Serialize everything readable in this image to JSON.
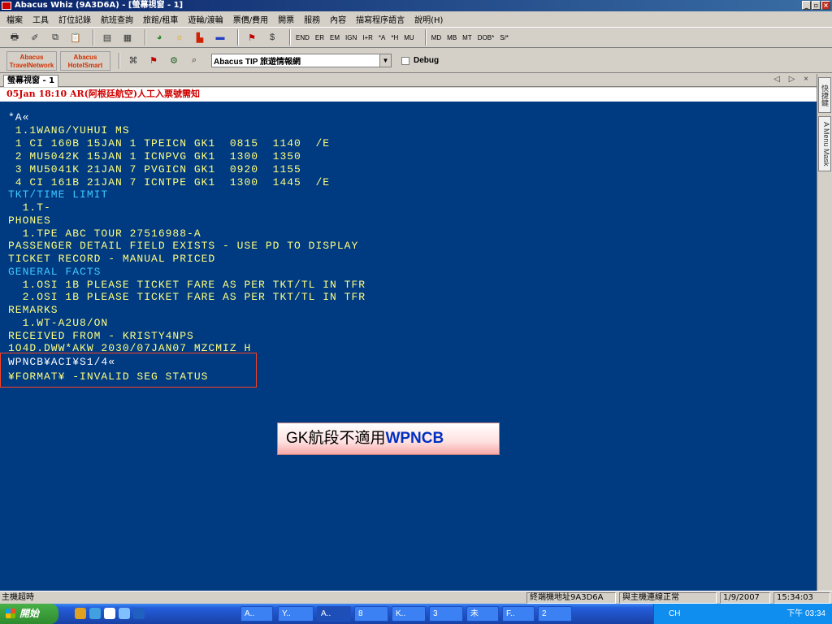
{
  "window": {
    "title": "Abacus Whiz (9A3D6A) - [螢幕視窗 - 1]",
    "minimize": "_",
    "restore": "▫",
    "close": "×"
  },
  "menu": [
    "檔案",
    "工具",
    "訂位記錄",
    "航班查詢",
    "旅館/租車",
    "遊輪/渡輪",
    "票價/費用",
    "開票",
    "服務",
    "內容",
    "描寫程序語言",
    "說明(H)"
  ],
  "toolbar1": {
    "icons": [
      "printer-icon",
      "eraser-icon",
      "copy-icon",
      "paste-icon",
      "document-icon",
      "form-icon",
      "globe-clock-icon",
      "weather-icon",
      "hotel-icon",
      "car-icon",
      "cruise-icon",
      "money-icon"
    ],
    "commands": [
      "END",
      "ER",
      "EM",
      "IGN",
      "I+R",
      "*A",
      "*H",
      "MU",
      "MD",
      "MB",
      "MT",
      "DOB*",
      "S/*"
    ]
  },
  "toolbar2": {
    "brand1": "Abacus TravelNetwork",
    "brand2": "Abacus HotelSmart",
    "combo_value": "Abacus TIP 旅遊情報網",
    "debug_label": "Debug"
  },
  "tab": {
    "label": "螢幕視窗 - 1",
    "nav": "◁ ▷ ×"
  },
  "notice": "05Jan 18:10 AR(阿根廷航空)人工入票號需知",
  "terminal_lines": [
    "*A«",
    " 1.1WANG/YUHUI MS",
    " 1 CI 160B 15JAN 1 TPEICN GK1  0815  1140  /E",
    " 2 MU5042K 15JAN 1 ICNPVG GK1  1300  1350",
    " 3 MU5041K 21JAN 7 PVGICN GK1  0920  1155",
    " 4 CI 161B 21JAN 7 ICNTPE GK1  1300  1445  /E",
    "TKT/TIME LIMIT",
    "  1.T-",
    "PHONES",
    "  1.TPE ABC TOUR 27516988-A",
    "PASSENGER DETAIL FIELD EXISTS - USE PD TO DISPLAY",
    "TICKET RECORD - MANUAL PRICED",
    "GENERAL FACTS",
    "  1.OSI 1B PLEASE TICKET FARE AS PER TKT/TL IN TFR",
    "  2.OSI 1B PLEASE TICKET FARE AS PER TKT/TL IN TFR",
    "REMARKS",
    "  1.WT-A2U8/ON",
    "RECEIVED FROM - KRISTY4NPS",
    "1O4D.DWW*AKW 2030/07JAN07 MZCMIZ H",
    "WPNCB¥ACI¥S1/4«",
    "¥FORMAT¥ -INVALID SEG STATUS"
  ],
  "callout": {
    "text": "GK航段不適用",
    "highlight": "WPNCB"
  },
  "sidebar": {
    "btn1": "快捷鍵",
    "btn2": "A Menu Mask"
  },
  "statusbar": {
    "left": "主機超時",
    "terminal_address": "終端機地址9A3D6A",
    "connection": "與主機連線正常",
    "date": "1/9/2007",
    "time": "15:34:03"
  },
  "taskbar": {
    "start": "開始",
    "buttons": [
      "A..",
      "Y..",
      "A..",
      "8",
      "K..",
      "3",
      "未",
      "F..",
      "2"
    ],
    "tray_lang": "CH",
    "tray_time": "下午 03:34"
  },
  "colors": {
    "terminal_bg": "#003a80",
    "notice_red": "#d00000",
    "highlight_box": "#ff4020"
  }
}
